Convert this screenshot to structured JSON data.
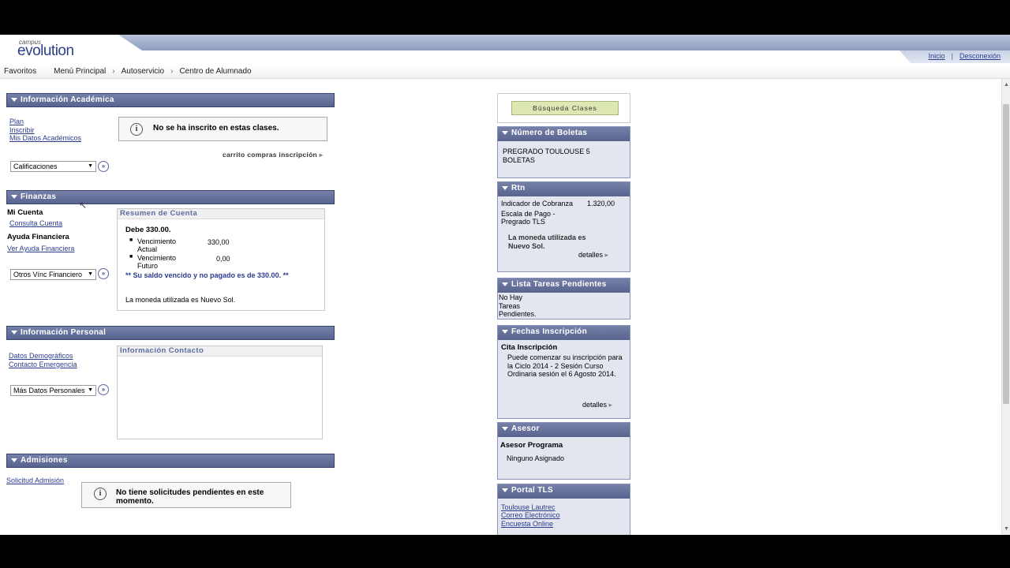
{
  "header": {
    "logo_small": "campus",
    "logo_main": "evolution",
    "inicio": "Inicio",
    "desconexion": "Desconexión"
  },
  "breadcrumb": [
    "Favoritos",
    "Menú Principal",
    "Autoservicio",
    "Centro de Alumnado"
  ],
  "academic": {
    "title": "Información Académica",
    "links": [
      "Plan",
      "Inscribir",
      "Mis Datos Académicos"
    ],
    "info_msg": "No se ha inscrito en estas clases.",
    "cart_link": "carrito compras inscripción",
    "select_value": "Calificaciones"
  },
  "finance": {
    "title": "Finanzas",
    "my_account": "Mi Cuenta",
    "account_link": "Consulta Cuenta",
    "aid_label": "Ayuda Financiera",
    "aid_link": "Ver Ayuda Financiera",
    "select_value": "Otros Vínc Financiero",
    "summary_title": "Resumen de Cuenta",
    "due": "Debe 330.00.",
    "rows": [
      {
        "label": "Vencimiento Actual",
        "value": "330,00"
      },
      {
        "label": "Vencimiento Futuro",
        "value": "0,00"
      }
    ],
    "overdue_msg": "** Su saldo vencido y no pagado es de 330.00. **",
    "currency_msg": "La moneda utilizada es Nuevo Sol."
  },
  "personal": {
    "title": "Información Personal",
    "links": [
      "Datos Demográficos",
      "Contacto Emergencia"
    ],
    "select_value": "Más Datos Personales",
    "contact_title": "Información Contacto"
  },
  "admissions": {
    "title": "Admisiones",
    "link": "Solicitud Admisión",
    "info_msg": "No tiene solicitudes pendientes en este momento."
  },
  "right": {
    "search_button": "Búsqueda Clases",
    "boletas": {
      "title": "Número de Boletas",
      "text": "PREGRADO TOULOUSE 5 BOLETAS"
    },
    "rtn": {
      "title": "Rtn",
      "indicator_label": "Indicador de Cobranza",
      "indicator_value": "1.320,00",
      "scale": "Escala de Pago - Pregrado TLS",
      "currency": "La moneda utilizada es Nuevo Sol.",
      "details": "detalles"
    },
    "tasks": {
      "title": "Lista Tareas Pendientes",
      "text": "No Hay Tareas Pendientes."
    },
    "enroll_dates": {
      "title": "Fechas Inscripción",
      "label": "Cita Inscripción",
      "text": "Puede comenzar su inscripción para la Ciclo 2014 - 2 Sesión Curso Ordinaria sesión el 6 Agosto 2014.",
      "details": "detalles"
    },
    "advisor": {
      "title": "Asesor",
      "label": "Asesor Programa",
      "value": "Ninguno Asignado"
    },
    "portal": {
      "title": "Portal TLS",
      "links": [
        "Toulouse Lautrec",
        "Correo Electrónico",
        "Encuesta Online"
      ]
    }
  }
}
